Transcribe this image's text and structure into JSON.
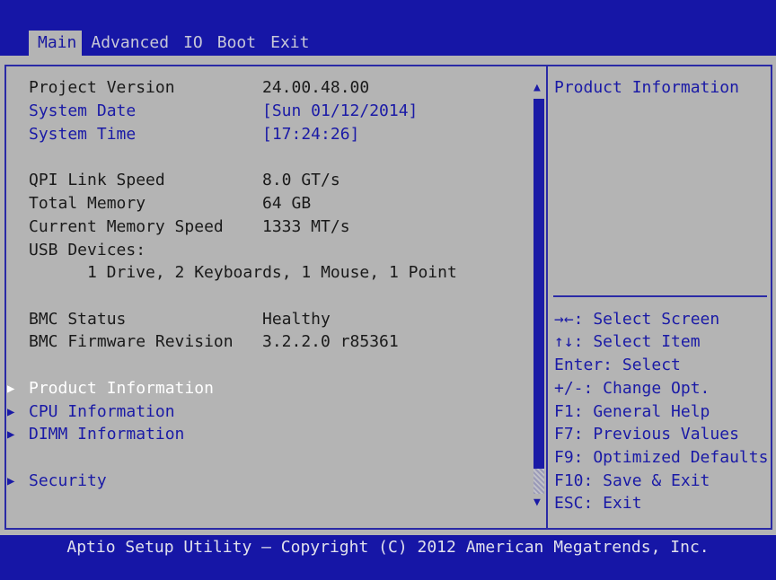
{
  "tabs": [
    "Main",
    "Advanced",
    "IO",
    "Boot",
    "Exit"
  ],
  "active_tab": "Main",
  "items": [
    {
      "label": "Project Version",
      "value": "24.00.48.00",
      "style": "static"
    },
    {
      "label": "System Date",
      "value": "[Sun 01/12/2014]",
      "style": "blue"
    },
    {
      "label": "System Time",
      "value": "[17:24:26]",
      "style": "blue"
    },
    {
      "label": "QPI Link Speed",
      "value": "8.0 GT/s",
      "style": "static"
    },
    {
      "label": "Total Memory",
      "value": "64 GB",
      "style": "static"
    },
    {
      "label": "Current Memory Speed",
      "value": "1333 MT/s",
      "style": "static"
    },
    {
      "label": "USB Devices:",
      "value": "",
      "style": "static"
    },
    {
      "label": "1 Drive, 2 Keyboards, 1 Mouse, 1 Point",
      "value": "",
      "style": "static"
    },
    {
      "label": "BMC Status",
      "value": "Healthy",
      "style": "static"
    },
    {
      "label": "BMC Firmware Revision",
      "value": "3.2.2.0 r85361",
      "style": "static"
    }
  ],
  "submenus": [
    "Product Information",
    "CPU Information",
    "DIMM Information",
    "Security"
  ],
  "selected_submenu": "Product Information",
  "help_title": "Product Information",
  "help_keys": [
    "→←: Select Screen",
    "↑↓: Select Item",
    "Enter: Select",
    "+/-: Change Opt.",
    "F1: General Help",
    "F7: Previous Values",
    "F9: Optimized Defaults",
    "F10: Save & Exit",
    "ESC: Exit"
  ],
  "footer": "Aptio Setup Utility – Copyright (C) 2012 American Megatrends, Inc.",
  "colors": {
    "background": "#1616a6",
    "panel": "#b4b4b4",
    "accent": "#1a1aa6"
  }
}
